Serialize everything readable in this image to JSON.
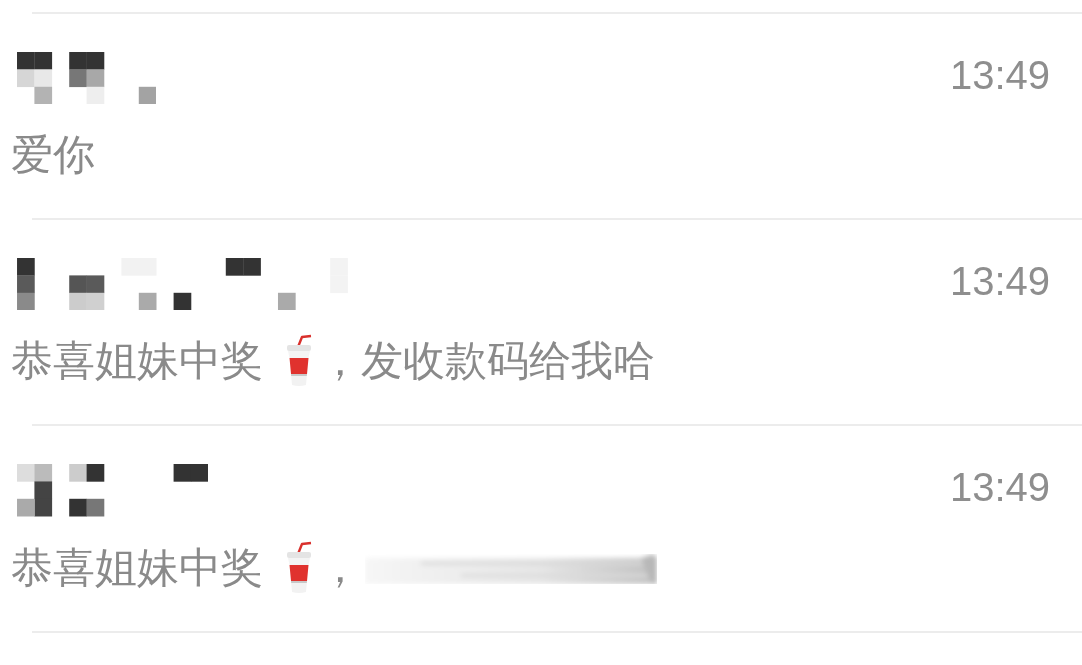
{
  "comments": [
    {
      "time": "13:49",
      "message": [
        {
          "kind": "text",
          "text": "爱你"
        }
      ]
    },
    {
      "time": "13:49",
      "message": [
        {
          "kind": "text",
          "text": "恭喜姐妹中奖"
        },
        {
          "kind": "emoji"
        },
        {
          "kind": "text",
          "text": "，发收款码给我哈"
        }
      ]
    },
    {
      "time": "13:49",
      "message": [
        {
          "kind": "text",
          "text": "恭喜姐妹中奖"
        },
        {
          "kind": "emoji"
        },
        {
          "kind": "text",
          "text": "，"
        },
        {
          "kind": "blurred"
        }
      ]
    }
  ]
}
